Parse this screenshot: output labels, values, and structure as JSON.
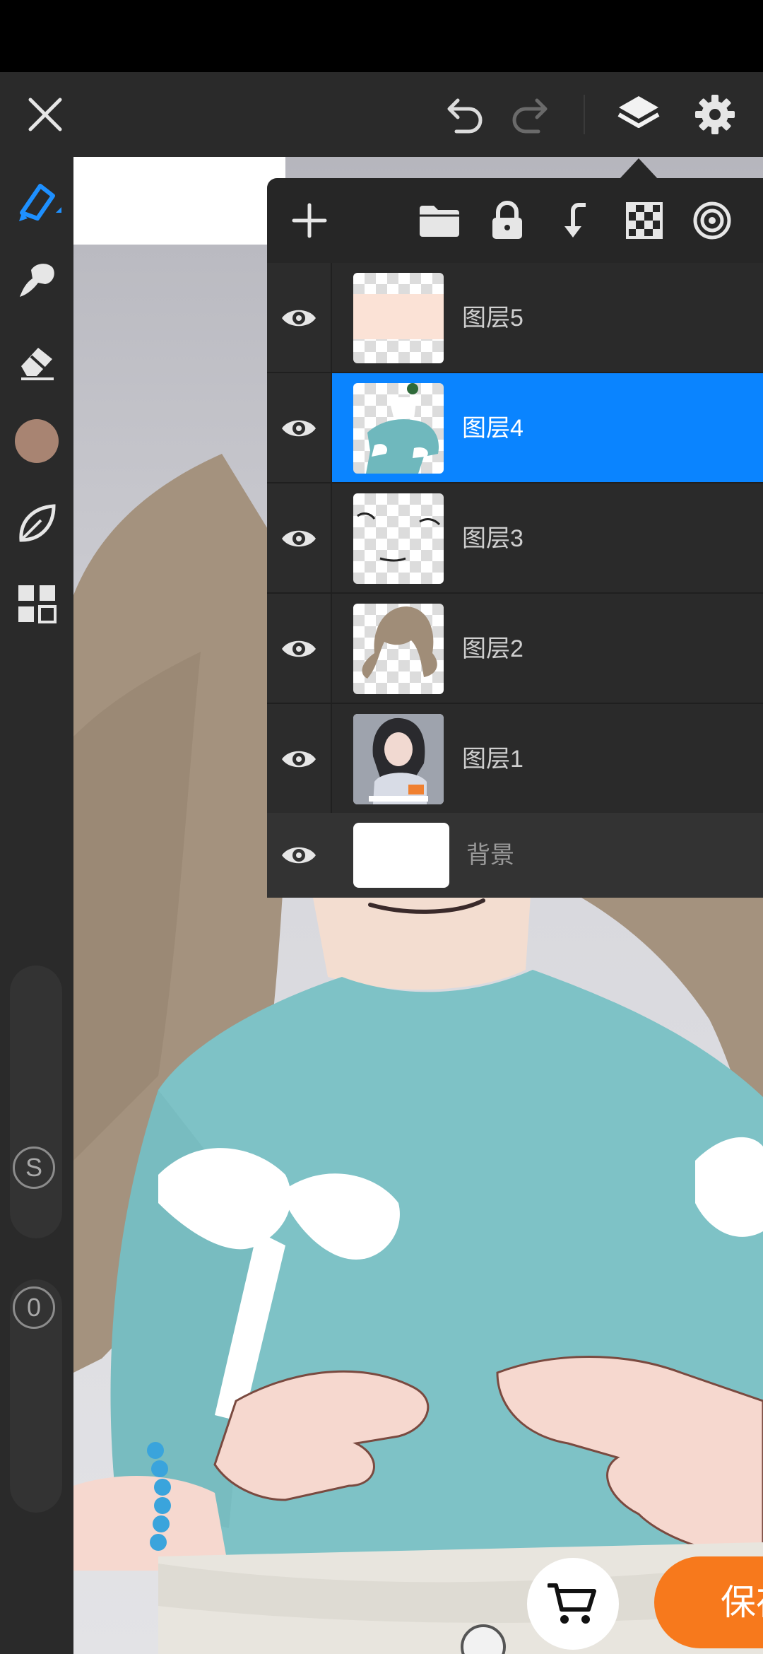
{
  "toolbar": {
    "close_icon": "close-icon",
    "undo_icon": "undo-icon",
    "redo_icon": "redo-icon",
    "layers_icon": "layers-icon",
    "settings_icon": "gear-icon"
  },
  "tools": {
    "brush_icon": "pen-icon",
    "smudge_icon": "smudge-icon",
    "eraser_icon": "eraser-icon",
    "current_color": "#a88472",
    "leaf_icon": "leaf-icon",
    "grid_icon": "grid-icon",
    "size_slider_label": "S",
    "opacity_slider_label": "0"
  },
  "layers_panel": {
    "layers": [
      {
        "name": "图层5",
        "visible": true,
        "selected": false
      },
      {
        "name": "图层4",
        "visible": true,
        "selected": true
      },
      {
        "name": "图层3",
        "visible": true,
        "selected": false
      },
      {
        "name": "图层2",
        "visible": true,
        "selected": false
      },
      {
        "name": "图层1",
        "visible": true,
        "selected": false
      }
    ],
    "background": {
      "name": "背景",
      "visible": true
    }
  },
  "bottom": {
    "save_label": "保存",
    "cart_icon": "cart-icon"
  },
  "colors": {
    "accent": "#0a84ff",
    "save": "#f7791c"
  }
}
